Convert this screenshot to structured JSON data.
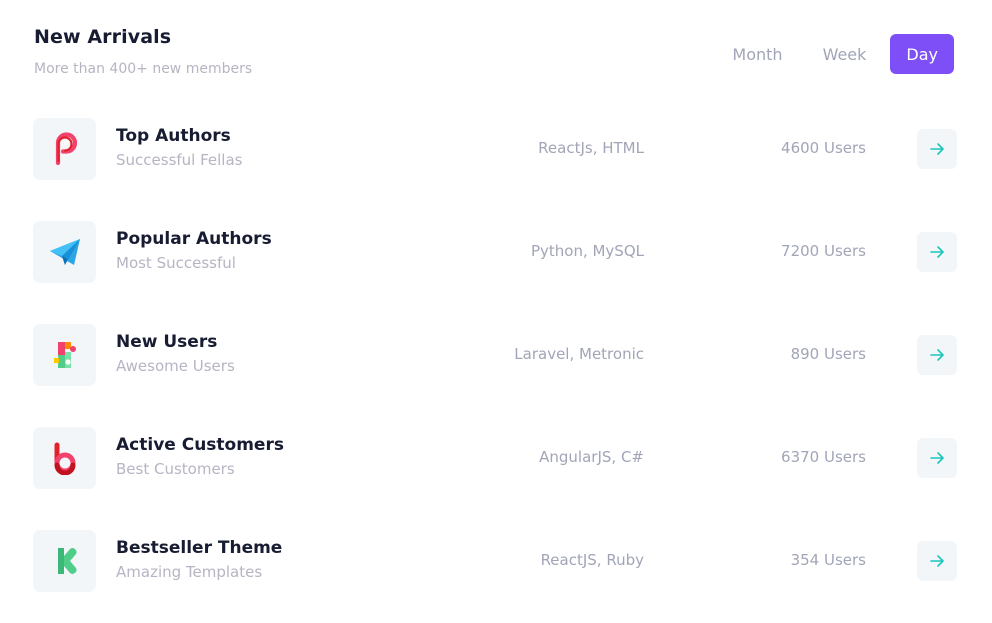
{
  "header": {
    "title": "New Arrivals",
    "subtitle": "More than 400+ new members"
  },
  "tabs": [
    {
      "label": "Month",
      "active": false
    },
    {
      "label": "Week",
      "active": false
    },
    {
      "label": "Day",
      "active": true
    }
  ],
  "colors": {
    "accent": "#7e4ff7",
    "arrow": "#1bc5bd",
    "muted": "#b5b5c3",
    "title": "#181c32"
  },
  "rows": [
    {
      "icon": "plurk-logo-icon",
      "name": "Top Authors",
      "desc": "Successful Fellas",
      "tech": "ReactJs, HTML",
      "users": "4600 Users"
    },
    {
      "icon": "telegram-logo-icon",
      "name": "Popular Authors",
      "desc": "Most Successful",
      "tech": "Python, MySQL",
      "users": "7200 Users"
    },
    {
      "icon": "vimeo-puzzle-logo-icon",
      "name": "New Users",
      "desc": "Awesome Users",
      "tech": "Laravel, Metronic",
      "users": "890 Users"
    },
    {
      "icon": "bebo-logo-icon",
      "name": "Active Customers",
      "desc": "Best Customers",
      "tech": "AngularJS, C#",
      "users": "6370 Users"
    },
    {
      "icon": "kickstarter-logo-icon",
      "name": "Bestseller Theme",
      "desc": "Amazing Templates",
      "tech": "ReactJS, Ruby",
      "users": "354 Users"
    }
  ]
}
